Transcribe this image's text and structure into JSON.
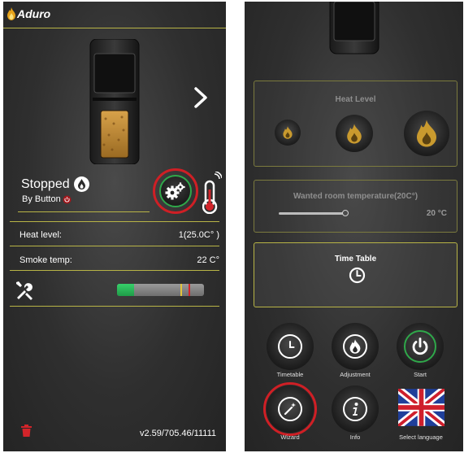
{
  "left_screen": {
    "brand": "Aduro",
    "status": {
      "state": "Stopped",
      "reason": "By Button"
    },
    "readings": [
      {
        "label": "Heat level:",
        "value": "1(25.0C° )"
      },
      {
        "label": "Smoke temp:",
        "value": "22 C°"
      }
    ],
    "progress": {
      "fill_fraction": 0.2,
      "marker1_fraction": 0.73,
      "marker2_fraction": 0.82
    },
    "version": "v2.59/705.46/11111"
  },
  "right_screen": {
    "heat_level": {
      "title": "Heat Level",
      "levels": [
        "flame-small-icon",
        "flame-medium-icon",
        "flame-large-icon"
      ]
    },
    "room_temperature": {
      "title": "Wanted room temperature(20C°)",
      "value": "20 °C",
      "slider_fraction": 1.0
    },
    "time_table": {
      "title": "Time Table"
    },
    "buttons": [
      {
        "label": "Timetable"
      },
      {
        "label": "Adjustment"
      },
      {
        "label": "Start"
      },
      {
        "label": "Wizard"
      },
      {
        "label": "Info"
      },
      {
        "label": "Select language"
      }
    ]
  },
  "colors": {
    "accent_line": "#b8b446",
    "highlight_ring": "#cf1f25",
    "active_green": "#2fa84a",
    "flame_gold": "#c99a2e"
  }
}
